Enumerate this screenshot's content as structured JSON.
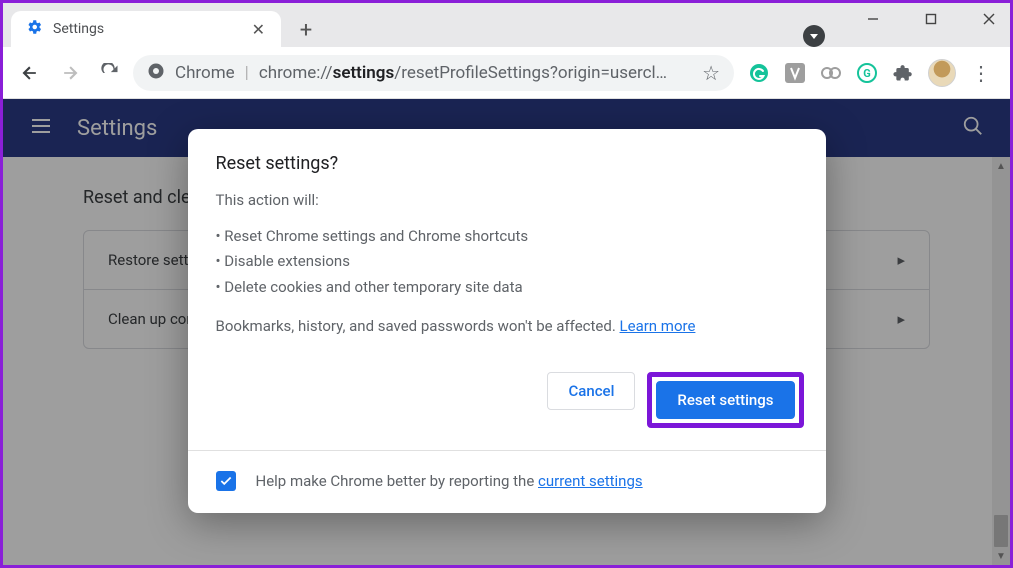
{
  "window": {
    "tab_title": "Settings"
  },
  "addressbar": {
    "protocol_label": "Chrome",
    "url_display_html": "chrome://<b>settings</b>/resetProfileSettings?origin=usercl…"
  },
  "header": {
    "title": "Settings"
  },
  "page": {
    "section": "Reset and clean up",
    "rows": [
      {
        "label": "Restore settings to their original defaults"
      },
      {
        "label": "Clean up computer"
      }
    ]
  },
  "dialog": {
    "title": "Reset settings?",
    "intro": "This action will:",
    "bullets": [
      "Reset Chrome settings and Chrome shortcuts",
      "Disable extensions",
      "Delete cookies and other temporary site data"
    ],
    "note_prefix": "Bookmarks, history, and saved passwords won't be affected. ",
    "learn_more": "Learn more",
    "cancel": "Cancel",
    "confirm": "Reset settings",
    "footer_prefix": "Help make Chrome better by reporting the ",
    "footer_link": "current settings",
    "footer_checked": true
  }
}
